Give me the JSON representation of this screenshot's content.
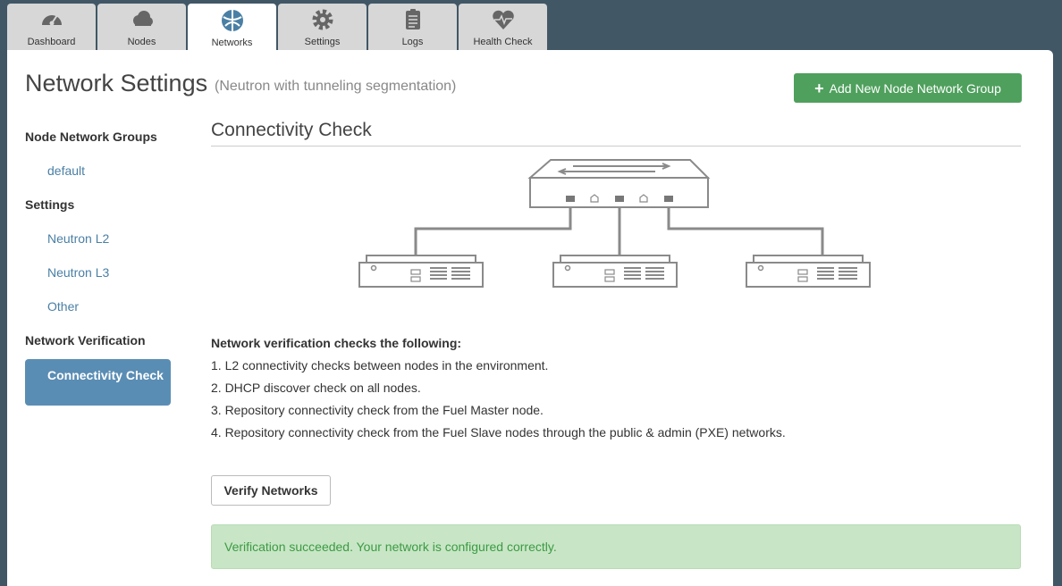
{
  "tabs": [
    {
      "label": "Dashboard",
      "icon": "dashboard-icon"
    },
    {
      "label": "Nodes",
      "icon": "cloud-icon"
    },
    {
      "label": "Networks",
      "icon": "network-icon",
      "active": true
    },
    {
      "label": "Settings",
      "icon": "gear-icon"
    },
    {
      "label": "Logs",
      "icon": "logs-icon"
    },
    {
      "label": "Health Check",
      "icon": "heart-pulse-icon"
    }
  ],
  "header": {
    "title": "Network Settings",
    "subtitle": "(Neutron with tunneling segmentation)",
    "add_button": "Add New Node Network Group"
  },
  "sidebar": {
    "groups_heading": "Node Network Groups",
    "groups": [
      "default"
    ],
    "settings_heading": "Settings",
    "settings": [
      "Neutron L2",
      "Neutron L3",
      "Other"
    ],
    "verification_heading": "Network Verification",
    "verification_item": "Connectivity Check"
  },
  "main": {
    "section_title": "Connectivity Check",
    "checks_title": "Network verification checks the following:",
    "checks": [
      "1. L2 connectivity checks between nodes in the environment.",
      "2. DHCP discover check on all nodes.",
      "3. Repository connectivity check from the Fuel Master node.",
      "4. Repository connectivity check from the Fuel Slave nodes through the public & admin (PXE) networks."
    ],
    "verify_button": "Verify Networks",
    "alert": "Verification succeeded. Your network is configured correctly."
  },
  "colors": {
    "background": "#415766",
    "accent_green": "#4fa05d",
    "link_blue": "#4a7fa5",
    "active_blue": "#5a8db4",
    "success_bg": "#c8e6c5",
    "success_text": "#3c9a45"
  }
}
